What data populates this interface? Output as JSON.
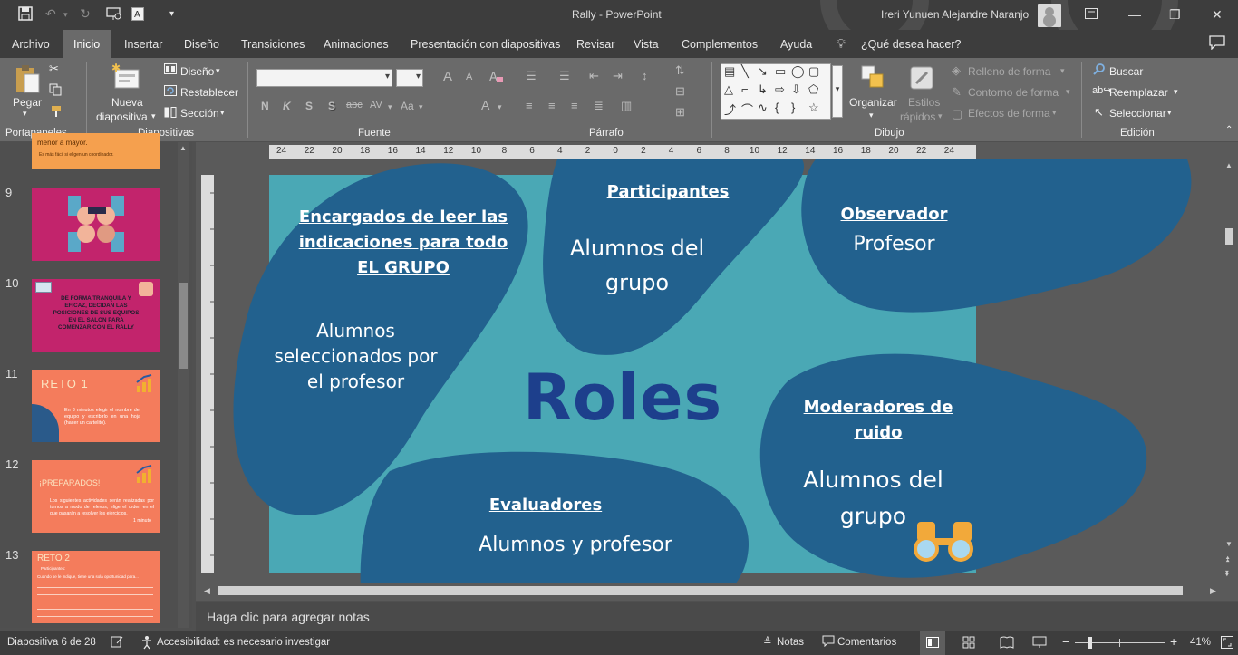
{
  "window": {
    "title": "Rally  -  PowerPoint",
    "user": "Ireri Yunuen Alejandre Naranjo"
  },
  "tabs": [
    {
      "label": "Archivo"
    },
    {
      "label": "Inicio"
    },
    {
      "label": "Insertar"
    },
    {
      "label": "Diseño"
    },
    {
      "label": "Transiciones"
    },
    {
      "label": "Animaciones"
    },
    {
      "label": "Presentación con diapositivas"
    },
    {
      "label": "Revisar"
    },
    {
      "label": "Vista"
    },
    {
      "label": "Complementos"
    },
    {
      "label": "Ayuda"
    },
    {
      "label": "¿Qué desea hacer?"
    }
  ],
  "ribbon": {
    "clipboard": {
      "paste": "Pegar",
      "group": "Portapapeles"
    },
    "slides": {
      "new_slide_1": "Nueva",
      "new_slide_2": "diapositiva",
      "layout": "Diseño",
      "reset": "Restablecer",
      "section": "Sección",
      "group": "Diapositivas"
    },
    "font": {
      "bold": "N",
      "italic": "K",
      "underline": "S",
      "shadow": "S",
      "strike": "abc",
      "spacing": "AV",
      "case": "Aa",
      "color": "A",
      "grow": "A",
      "shrink": "A",
      "group": "Fuente"
    },
    "paragraph": {
      "group": "Párrafo"
    },
    "drawing": {
      "arrange": "Organizar",
      "quick_styles_1": "Estilos",
      "quick_styles_2": "rápidos",
      "fill": "Relleno de forma",
      "outline": "Contorno de forma",
      "effects": "Efectos de forma",
      "group": "Dibujo"
    },
    "editing": {
      "find": "Buscar",
      "replace": "Reemplazar",
      "select": "Seleccionar",
      "group": "Edición"
    }
  },
  "ruler_labels": [
    "24",
    "22",
    "20",
    "18",
    "16",
    "14",
    "12",
    "10",
    "8",
    "6",
    "4",
    "2",
    "0",
    "2",
    "4",
    "6",
    "8",
    "10",
    "12",
    "14",
    "16",
    "18",
    "20",
    "22",
    "24"
  ],
  "thumbnails": {
    "top_partial": {
      "line1": "menor a mayor.",
      "line2": "Es más fácil si eligen un coordinador."
    },
    "items": [
      {
        "num": "9",
        "text": ""
      },
      {
        "num": "10",
        "text": "DE FORMA TRANQUILA Y EFICAZ, DECIDAN LAS POSICIONES DE SUS EQUIPOS EN EL SALON PARA COMENZAR CON EL RALLY"
      },
      {
        "num": "11",
        "title": "RETO 1",
        "text": "En 3 minutos elegir el nombre del equipo y escribirlo en una hoja (hacer un cartelito)."
      },
      {
        "num": "12",
        "title": "¡PREPARADOS!",
        "text": "Los siguientes actividades serán realizadas por turnos a modo de relevos, elige el orden en el que pasarán a resolver los ejercicios.",
        "extra": "1 minuto"
      },
      {
        "num": "13",
        "title": "RETO 2",
        "subtitle": "Participantes:",
        "text": "Cuando se le indique, tiene una sola oportunidad para..."
      }
    ]
  },
  "slide": {
    "roles": "Roles",
    "encargados_title_1": "Encargados de leer las",
    "encargados_title_2": "indicaciones  para todo",
    "encargados_title_3": "EL GRUPO",
    "encargados_body_1": "Alumnos",
    "encargados_body_2": "seleccionados por",
    "encargados_body_3": "el profesor",
    "participantes_title": "Participantes",
    "participantes_body_1": "Alumnos del",
    "participantes_body_2": "grupo",
    "observador_title": "Observador",
    "observador_body": "Profesor",
    "moderadores_title_1": "Moderadores de",
    "moderadores_title_2": "ruido",
    "moderadores_body_1": "Alumnos del",
    "moderadores_body_2": "grupo",
    "evaluadores_title": "Evaluadores",
    "evaluadores_body": "Alumnos y profesor",
    "colors": {
      "bg": "#4aa8b5",
      "blob": "#22618e",
      "roles": "#1d3f8c"
    }
  },
  "notes_placeholder": "Haga clic para agregar notas",
  "status": {
    "slide_count": "Diapositiva 6 de 28",
    "accessibility": "Accesibilidad: es necesario investigar",
    "notes": "Notas",
    "comments": "Comentarios",
    "zoom": "41%",
    "zoom_fraction": 0.41
  }
}
